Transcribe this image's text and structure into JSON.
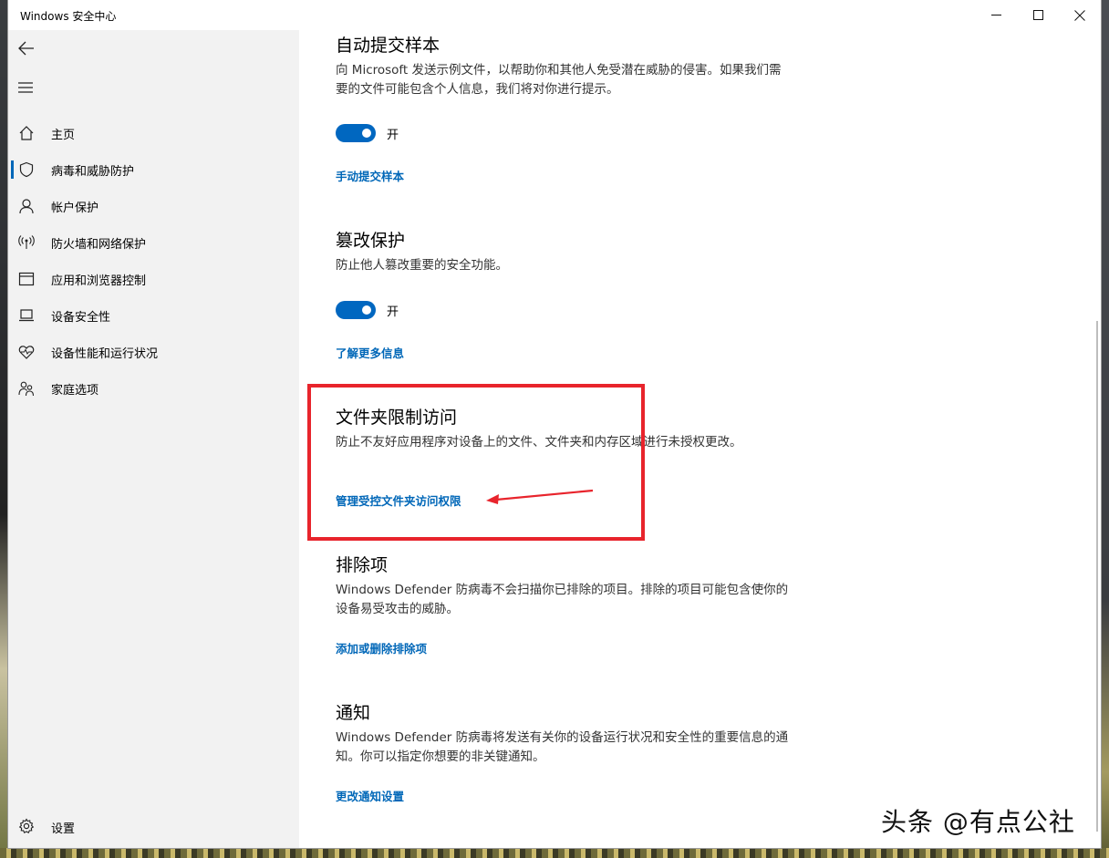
{
  "window": {
    "title": "Windows 安全中心"
  },
  "sidebar": {
    "items": [
      {
        "label": "主页",
        "icon": "home-icon"
      },
      {
        "label": "病毒和威胁防护",
        "icon": "shield-icon",
        "active": true
      },
      {
        "label": "帐户保护",
        "icon": "person-icon"
      },
      {
        "label": "防火墙和网络保护",
        "icon": "antenna-icon"
      },
      {
        "label": "应用和浏览器控制",
        "icon": "browser-window-icon"
      },
      {
        "label": "设备安全性",
        "icon": "laptop-icon"
      },
      {
        "label": "设备性能和运行状况",
        "icon": "heart-pulse-icon"
      },
      {
        "label": "家庭选项",
        "icon": "family-icon"
      }
    ],
    "settings_label": "设置"
  },
  "sections": {
    "auto_submit": {
      "title": "自动提交样本",
      "desc": "向 Microsoft 发送示例文件，以帮助你和其他人免受潜在威胁的侵害。如果我们需要的文件可能包含个人信息，我们将对你进行提示。",
      "toggle_label": "开",
      "link": "手动提交样本"
    },
    "tamper": {
      "title": "篡改保护",
      "desc": "防止他人篡改重要的安全功能。",
      "toggle_label": "开",
      "link": "了解更多信息"
    },
    "folder_access": {
      "title": "文件夹限制访问",
      "desc": "防止不友好应用程序对设备上的文件、文件夹和内存区域进行未授权更改。",
      "link": "管理受控文件夹访问权限"
    },
    "exclusions": {
      "title": "排除项",
      "desc": "Windows Defender 防病毒不会扫描你已排除的项目。排除的项目可能包含使你的设备易受攻击的威胁。",
      "link": "添加或删除排除项"
    },
    "notifications": {
      "title": "通知",
      "desc": "Windows Defender 防病毒将发送有关你的设备运行状况和安全性的重要信息的通知。你可以指定你想要的非关键通知。",
      "link": "更改通知设置"
    }
  },
  "watermark": "头条 @有点公社",
  "colors": {
    "accent": "#0067b8",
    "toggle_on": "#0067c0",
    "highlight": "#e8242c"
  }
}
